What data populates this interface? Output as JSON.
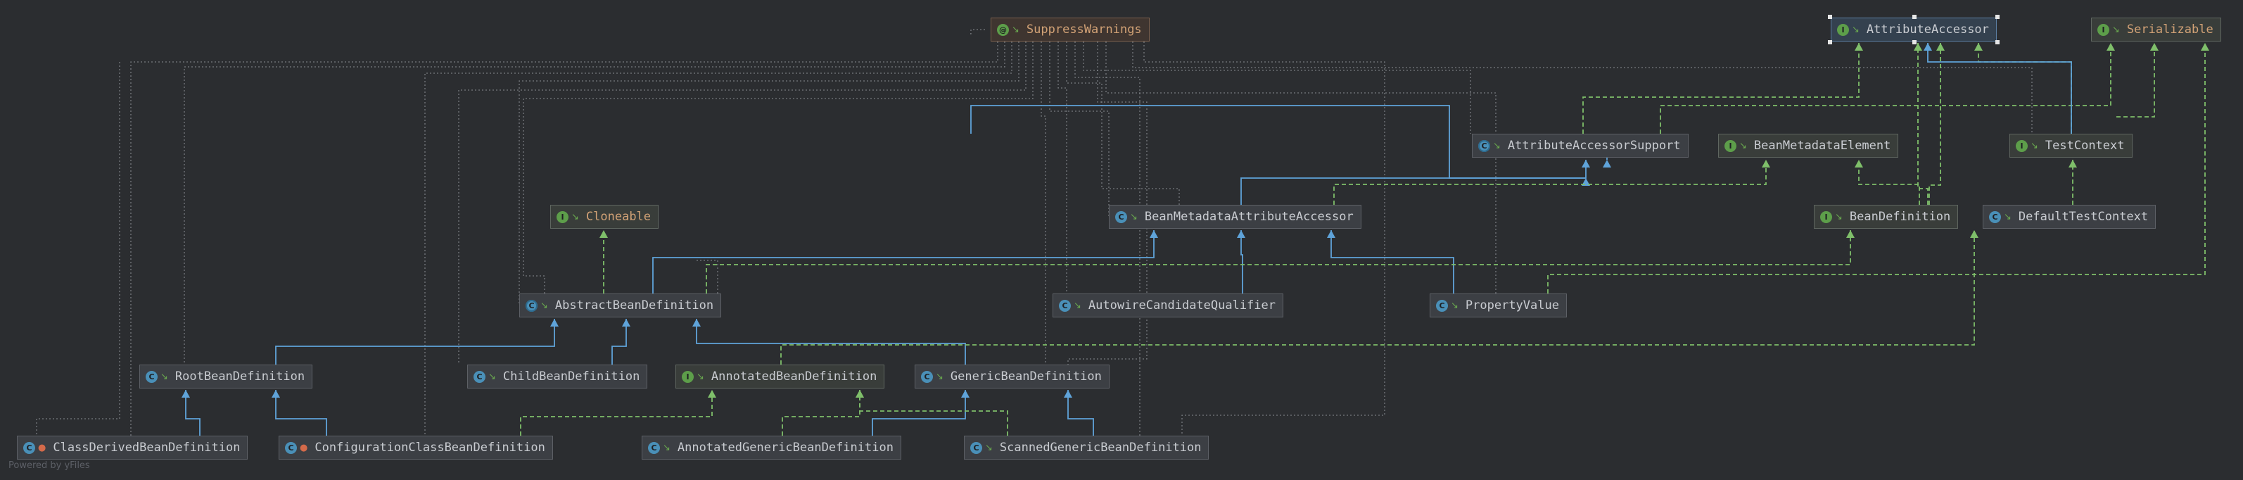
{
  "diagram": {
    "footer": "Powered by yFiles",
    "nodes": {
      "suppress": {
        "label": "SuppressWarnings",
        "kind": "annotation",
        "badge": "@"
      },
      "attr_accessor": {
        "label": "AttributeAccessor",
        "kind": "interface",
        "badge": "I",
        "selected": true
      },
      "serializable": {
        "label": "Serializable",
        "kind": "interface",
        "badge": "I"
      },
      "attr_accessor_support": {
        "label": "AttributeAccessorSupport",
        "kind": "abstract",
        "badge": "C"
      },
      "bean_metadata_element": {
        "label": "BeanMetadataElement",
        "kind": "interface",
        "badge": "I"
      },
      "test_context": {
        "label": "TestContext",
        "kind": "interface",
        "badge": "I"
      },
      "cloneable": {
        "label": "Cloneable",
        "kind": "interface",
        "badge": "I"
      },
      "bean_metadata_attr_accessor": {
        "label": "BeanMetadataAttributeAccessor",
        "kind": "class",
        "badge": "C"
      },
      "bean_definition": {
        "label": "BeanDefinition",
        "kind": "interface",
        "badge": "I"
      },
      "default_test_context": {
        "label": "DefaultTestContext",
        "kind": "class",
        "badge": "C"
      },
      "abstract_bean_def": {
        "label": "AbstractBeanDefinition",
        "kind": "abstract",
        "badge": "C"
      },
      "autowire_candidate": {
        "label": "AutowireCandidateQualifier",
        "kind": "class",
        "badge": "C"
      },
      "property_value": {
        "label": "PropertyValue",
        "kind": "class",
        "badge": "C"
      },
      "root_bean_def": {
        "label": "RootBeanDefinition",
        "kind": "class",
        "badge": "C"
      },
      "child_bean_def": {
        "label": "ChildBeanDefinition",
        "kind": "class",
        "badge": "C"
      },
      "annotated_bean_def": {
        "label": "AnnotatedBeanDefinition",
        "kind": "interface",
        "badge": "I"
      },
      "generic_bean_def": {
        "label": "GenericBeanDefinition",
        "kind": "class",
        "badge": "C"
      },
      "class_derived_bean_def": {
        "label": "ClassDerivedBeanDefinition",
        "kind": "class",
        "badge": "C"
      },
      "config_class_bean_def": {
        "label": "ConfigurationClassBeanDefinition",
        "kind": "class",
        "badge": "C"
      },
      "annotated_generic_bean_def": {
        "label": "AnnotatedGenericBeanDefinition",
        "kind": "class",
        "badge": "C"
      },
      "scanned_generic_bean_def": {
        "label": "ScannedGenericBeanDefinition",
        "kind": "class",
        "badge": "C"
      }
    },
    "colors": {
      "background": "#2b2d30",
      "extends_edge": "#5fa3d9",
      "implements_edge": "#7fbf6a",
      "dependency_edge": "#8a8d93"
    }
  }
}
